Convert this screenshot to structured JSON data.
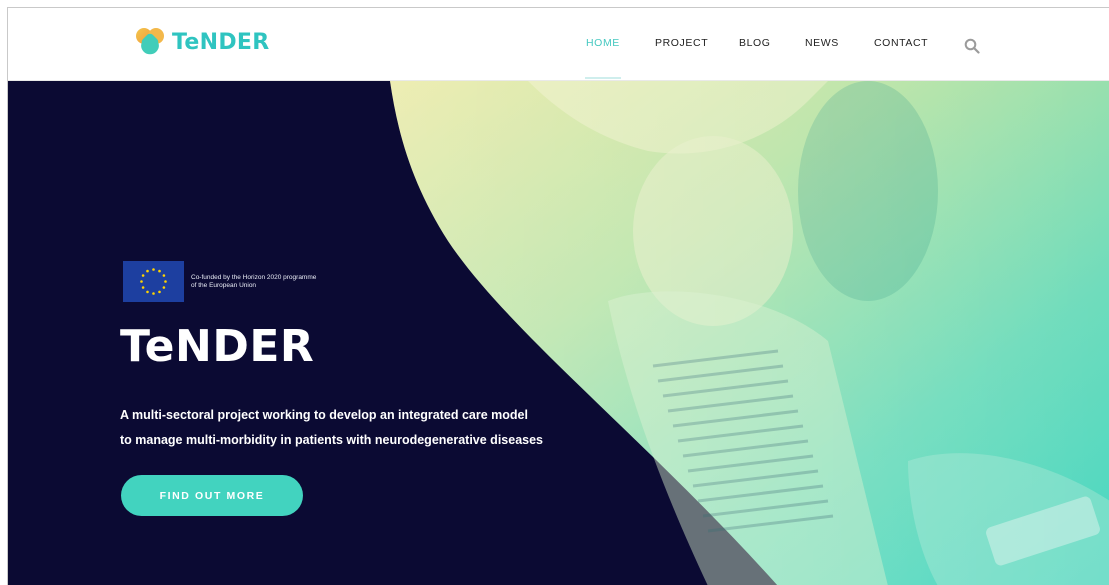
{
  "header": {
    "brand": "TeNDER",
    "nav": [
      {
        "label": "HOME",
        "active": true
      },
      {
        "label": "PROJECT",
        "active": false
      },
      {
        "label": "BLOG",
        "active": false
      },
      {
        "label": "NEWS",
        "active": false
      },
      {
        "label": "CONTACT",
        "active": false
      }
    ],
    "search_icon": "search-icon"
  },
  "hero": {
    "eu_line1": "Co-funded by the Horizon 2020 programme",
    "eu_line2": "of the European Union",
    "title": "TeNDER",
    "subtitle_line1": "A multi-sectoral project working to develop an integrated care model",
    "subtitle_line2": "to manage multi-morbidity in patients with neurodegenerative diseases",
    "cta_label": "FIND OUT MORE"
  },
  "colors": {
    "accent": "#45c8c0",
    "hero_bg": "#0b0a33",
    "button": "#42d3bf",
    "eu_flag": "#1d3fa0",
    "eu_star": "#ffd400"
  }
}
